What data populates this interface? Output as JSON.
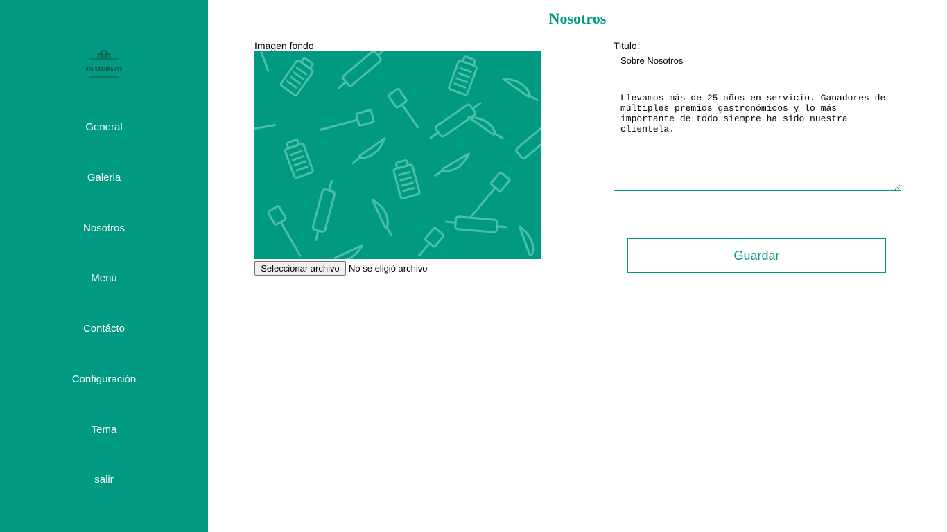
{
  "sidebar": {
    "logo_text": "MOLSTAURANTE",
    "items": [
      {
        "label": "General"
      },
      {
        "label": "Galeria"
      },
      {
        "label": "Nosotros"
      },
      {
        "label": "Menú"
      },
      {
        "label": "Contácto"
      },
      {
        "label": "Configuración"
      },
      {
        "label": "Tema"
      },
      {
        "label": "salir"
      }
    ]
  },
  "page": {
    "title": "Nosotros"
  },
  "image_section": {
    "label": "Imagen fondo",
    "file_button": "Seleccionar archivo",
    "file_status": "No se eligió archivo"
  },
  "form": {
    "title_label": "Titulo:",
    "title_value": "Sobre Nosotros",
    "description_value": "Llevamos más de 25 años en servicio. Ganadores de múltiples premios gastronómicos y lo más importante de todo siempre ha sido nuestra clientela.",
    "save_label": "Guardar"
  },
  "colors": {
    "accent": "#009a82",
    "pattern": "#4dbfa9"
  }
}
